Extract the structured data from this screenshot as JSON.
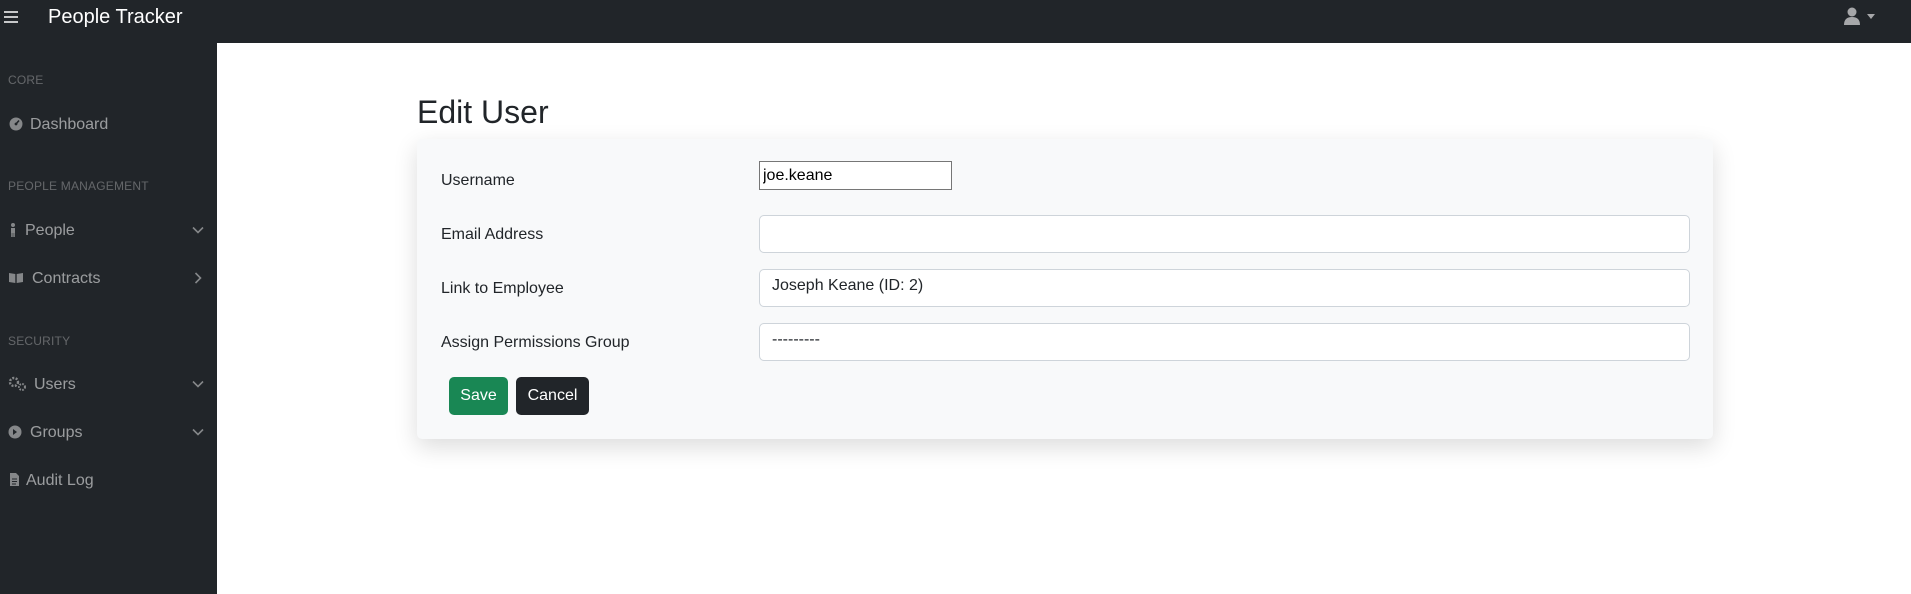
{
  "app": {
    "brand": "People Tracker"
  },
  "sidebar": {
    "headings": {
      "core": "CORE",
      "people": "PEOPLE MANAGEMENT",
      "security": "SECURITY"
    },
    "items": [
      {
        "label": "Dashboard",
        "icon": "dashboard-icon"
      },
      {
        "label": "People",
        "icon": "person-icon",
        "chevron": "down"
      },
      {
        "label": "Contracts",
        "icon": "book-icon",
        "chevron": "right"
      },
      {
        "label": "Users",
        "icon": "gears-icon",
        "chevron": "down"
      },
      {
        "label": "Groups",
        "icon": "group-icon",
        "chevron": "down"
      },
      {
        "label": "Audit Log",
        "icon": "document-icon"
      }
    ]
  },
  "page": {
    "title": "Edit User"
  },
  "form": {
    "username": {
      "label": "Username",
      "value": "joe.keane"
    },
    "email": {
      "label": "Email Address",
      "value": ""
    },
    "employee": {
      "label": "Link to Employee",
      "value": "Joseph Keane (ID: 2)"
    },
    "group": {
      "label": "Assign Permissions Group",
      "value": "---------"
    },
    "save_label": "Save",
    "cancel_label": "Cancel"
  },
  "colors": {
    "sidebar_bg": "#212529",
    "save": "#198754",
    "cancel": "#212529"
  }
}
